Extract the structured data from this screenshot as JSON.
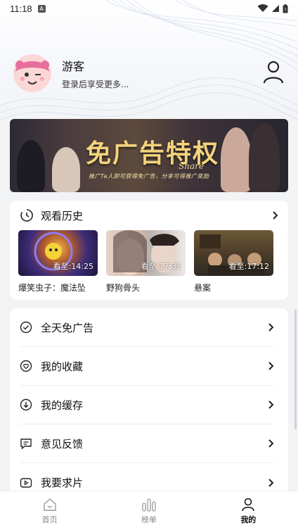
{
  "status_bar": {
    "time": "11:18",
    "notification_icon": "A"
  },
  "profile": {
    "name": "游客",
    "subtitle": "登录后享受更多..."
  },
  "banner": {
    "title": "免广告特权",
    "share_text": "Share",
    "description": "推广Ta人即可获得免广告，分享可得推广奖励"
  },
  "history": {
    "title": "观看历史",
    "items": [
      {
        "title": "爆笑虫子：魔法坠",
        "watched": "看至:14:25"
      },
      {
        "title": "野狗骨头",
        "watched": "看至:17:31"
      },
      {
        "title": "悬案",
        "watched": "看至:17:12"
      }
    ]
  },
  "menu": {
    "items": [
      {
        "label": "全天免广告",
        "icon": "check-circle-icon"
      },
      {
        "label": "我的收藏",
        "icon": "heart-circle-icon"
      },
      {
        "label": "我的缓存",
        "icon": "download-circle-icon"
      },
      {
        "label": "意见反馈",
        "icon": "message-icon"
      },
      {
        "label": "我要求片",
        "icon": "video-icon"
      }
    ]
  },
  "bottom_nav": {
    "items": [
      {
        "label": "首页",
        "icon": "home-icon",
        "active": false
      },
      {
        "label": "榜单",
        "icon": "chart-icon",
        "active": false
      },
      {
        "label": "我的",
        "icon": "user-icon",
        "active": true
      }
    ]
  }
}
